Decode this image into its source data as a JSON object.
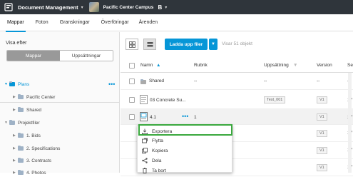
{
  "topbar": {
    "app_title": "Document Management",
    "project_title": "Pacific Center Campus",
    "b_label": "B"
  },
  "tabs": [
    "Mappar",
    "Foton",
    "Granskningar",
    "Överföringar",
    "Ärenden"
  ],
  "sidebar": {
    "view_label": "Visa efter",
    "seg_folders": "Mappar",
    "seg_sets": "Uppsättningar",
    "tree": {
      "plans": "Plans",
      "pacific_center": "Pacific Center",
      "shared": "Shared",
      "project_files": "Projektfiler",
      "bids": "1. Bids",
      "specifications": "2. Specifications",
      "contracts": "3. Contracts",
      "photos": "4. Photos"
    },
    "more": "•••"
  },
  "toolbar": {
    "upload_label": "Ladda upp filer",
    "count_label": "Visar 51 objekt"
  },
  "table": {
    "headers": [
      "Namn",
      "Rubrik",
      "Uppsättning",
      "Version",
      "Se"
    ],
    "rows": [
      {
        "name": "Shared",
        "rubrik": "--",
        "set": "--",
        "version": "--",
        "extra": "--"
      },
      {
        "name": "03 Concrete Su...",
        "rubrik": "",
        "set": "Test_001",
        "version": "V1",
        "extra": "17"
      },
      {
        "name": "4.1",
        "rubrik": "1",
        "set": "",
        "version": "V1",
        "extra": "17"
      },
      {
        "name": "",
        "rubrik": "",
        "set": "",
        "version": "V1",
        "extra": "17"
      },
      {
        "name": "",
        "rubrik": "",
        "set": "",
        "version": "V1",
        "extra": "17"
      },
      {
        "name": "",
        "rubrik": "",
        "set": "",
        "version": "V1",
        "extra": "17"
      }
    ],
    "row_more": "•••"
  },
  "menu": {
    "items": [
      "Exportera",
      "Flytta",
      "Kopiera",
      "Dela",
      "Ta bort"
    ]
  }
}
